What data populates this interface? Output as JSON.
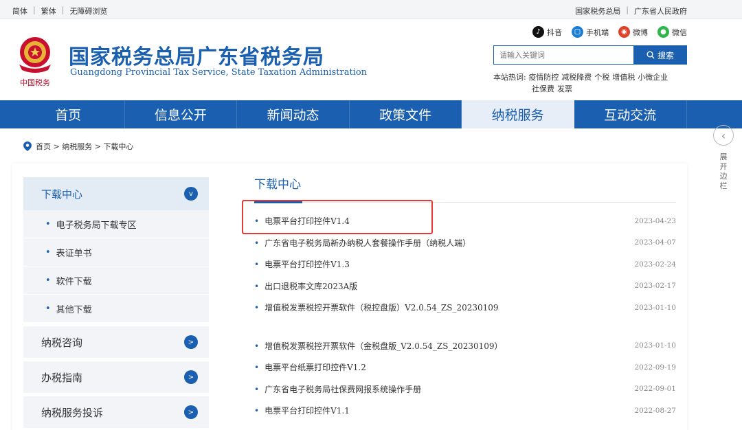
{
  "topbar": {
    "left_links": [
      "简体",
      "繁体",
      "无障碍浏览"
    ],
    "right_links": [
      "国家税务总局",
      "广东省人民政府"
    ]
  },
  "header": {
    "title_cn": "国家税务总局广东省税务局",
    "title_en": "Guangdong Provincial Tax Service, State Taxation Administration",
    "social": [
      {
        "label": "抖音",
        "icon": "douyin-icon",
        "color": "#111111",
        "glyph": "♪"
      },
      {
        "label": "手机端",
        "icon": "mobile-icon",
        "color": "#1a7fd4",
        "glyph": "▢"
      },
      {
        "label": "微博",
        "icon": "weibo-icon",
        "color": "#e0412b",
        "glyph": "◉"
      },
      {
        "label": "微信",
        "icon": "wechat-icon",
        "color": "#2fb64b",
        "glyph": "●"
      }
    ],
    "search_placeholder": "请输入关键词",
    "search_button": "搜索",
    "hot_label": "本站热词:",
    "hot_words": [
      "疫情防控",
      "减税降费",
      "个税",
      "增值税",
      "小微企业",
      "社保费",
      "发票"
    ]
  },
  "nav": {
    "items": [
      "首页",
      "信息公开",
      "新闻动态",
      "政策文件",
      "纳税服务",
      "互动交流"
    ],
    "active_index": 4
  },
  "side_expand": {
    "label": "展开边栏"
  },
  "breadcrumb": {
    "home": "首页",
    "level1": "纳税服务",
    "level2": "下载中心",
    "sep": ">"
  },
  "sidebar": {
    "head": {
      "label": "下载中心",
      "badge": "v"
    },
    "sub_items": [
      "电子税务局下载专区",
      "表证单书",
      "软件下载",
      "其他下载"
    ],
    "items": [
      {
        "label": "纳税咨询",
        "badge": ">"
      },
      {
        "label": "办税指南",
        "badge": ">"
      },
      {
        "label": "纳税服务投诉",
        "badge": ">"
      }
    ]
  },
  "main": {
    "title": "下载中心",
    "group1": [
      {
        "title": "电票平台打印控件V1.4",
        "date": "2023-04-23"
      },
      {
        "title": "广东省电子税务局新办纳税人套餐操作手册（纳税人端）",
        "date": "2023-04-07"
      },
      {
        "title": "电票平台打印控件V1.3",
        "date": "2023-02-24"
      },
      {
        "title": "出口退税率文库2023A版",
        "date": "2023-02-17"
      },
      {
        "title": "增值税发票税控开票软件（税控盘版）V2.0.54_ZS_20230109",
        "date": "2023-01-10"
      }
    ],
    "group2": [
      {
        "title": "增值税发票税控开票软件（金税盘版_V2.0.54_ZS_20230109）",
        "date": "2023-01-10"
      },
      {
        "title": "电票平台纸票打印控件V1.2",
        "date": "2022-09-19"
      },
      {
        "title": "广东省电子税务局社保费网报系统操作手册",
        "date": "2022-09-01"
      },
      {
        "title": "电票平台打印控件V1.1",
        "date": "2022-08-27"
      }
    ]
  },
  "colors": {
    "primary": "#1a5fb0",
    "highlight": "#e53935",
    "nav_active_bg": "#e8eef7"
  }
}
